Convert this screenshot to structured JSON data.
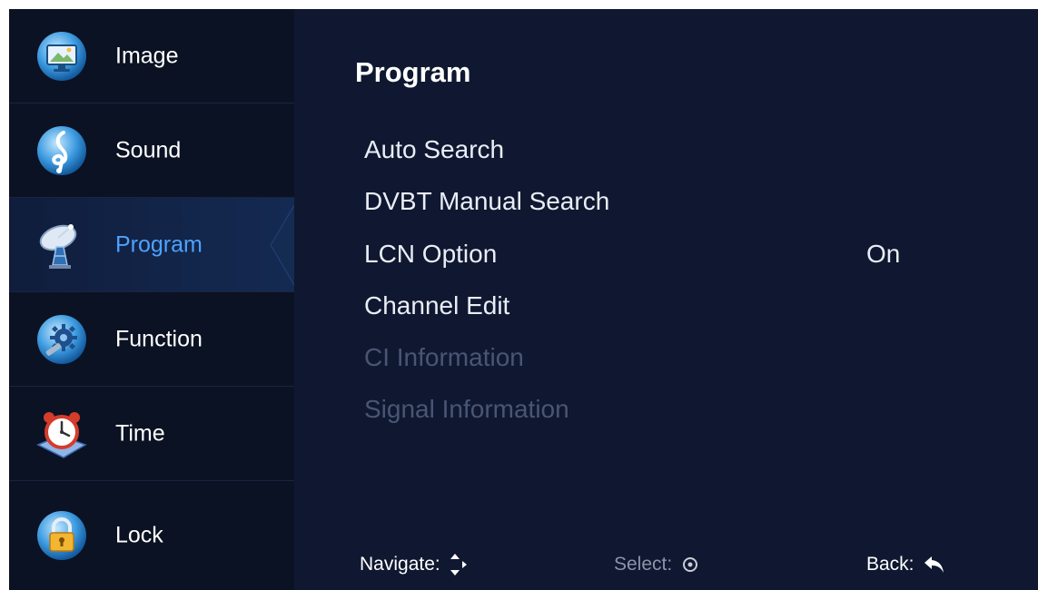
{
  "sidebar": {
    "items": [
      {
        "label": "Image",
        "icon": "monitor-icon"
      },
      {
        "label": "Sound",
        "icon": "treble-clef-icon"
      },
      {
        "label": "Program",
        "icon": "satellite-dish-icon",
        "active": true
      },
      {
        "label": "Function",
        "icon": "gear-icon"
      },
      {
        "label": "Time",
        "icon": "alarm-clock-icon"
      },
      {
        "label": "Lock",
        "icon": "padlock-icon"
      }
    ]
  },
  "main": {
    "title": "Program",
    "items": [
      {
        "label": "Auto Search",
        "value": "",
        "enabled": true
      },
      {
        "label": "DVBT Manual Search",
        "value": "",
        "enabled": true
      },
      {
        "label": "LCN Option",
        "value": "On",
        "enabled": true
      },
      {
        "label": "Channel Edit",
        "value": "",
        "enabled": true
      },
      {
        "label": "CI Information",
        "value": "",
        "enabled": false
      },
      {
        "label": "Signal Information",
        "value": "",
        "enabled": false
      }
    ]
  },
  "footer": {
    "navigate": "Navigate:",
    "select": "Select:",
    "back": "Back:"
  },
  "colors": {
    "background": "#0f1830",
    "sidebar": "#0b1223",
    "active_text": "#4ea2ff",
    "disabled_text": "#4a5574"
  }
}
